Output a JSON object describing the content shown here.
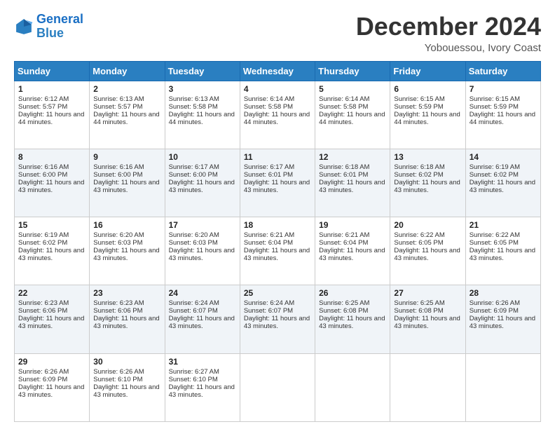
{
  "header": {
    "logo_line1": "General",
    "logo_line2": "Blue",
    "month": "December 2024",
    "location": "Yobouessou, Ivory Coast"
  },
  "weekdays": [
    "Sunday",
    "Monday",
    "Tuesday",
    "Wednesday",
    "Thursday",
    "Friday",
    "Saturday"
  ],
  "weeks": [
    [
      {
        "day": "1",
        "sunrise": "6:12 AM",
        "sunset": "5:57 PM",
        "daylight": "11 hours and 44 minutes."
      },
      {
        "day": "2",
        "sunrise": "6:13 AM",
        "sunset": "5:57 PM",
        "daylight": "11 hours and 44 minutes."
      },
      {
        "day": "3",
        "sunrise": "6:13 AM",
        "sunset": "5:58 PM",
        "daylight": "11 hours and 44 minutes."
      },
      {
        "day": "4",
        "sunrise": "6:14 AM",
        "sunset": "5:58 PM",
        "daylight": "11 hours and 44 minutes."
      },
      {
        "day": "5",
        "sunrise": "6:14 AM",
        "sunset": "5:58 PM",
        "daylight": "11 hours and 44 minutes."
      },
      {
        "day": "6",
        "sunrise": "6:15 AM",
        "sunset": "5:59 PM",
        "daylight": "11 hours and 44 minutes."
      },
      {
        "day": "7",
        "sunrise": "6:15 AM",
        "sunset": "5:59 PM",
        "daylight": "11 hours and 44 minutes."
      }
    ],
    [
      {
        "day": "8",
        "sunrise": "6:16 AM",
        "sunset": "6:00 PM",
        "daylight": "11 hours and 43 minutes."
      },
      {
        "day": "9",
        "sunrise": "6:16 AM",
        "sunset": "6:00 PM",
        "daylight": "11 hours and 43 minutes."
      },
      {
        "day": "10",
        "sunrise": "6:17 AM",
        "sunset": "6:00 PM",
        "daylight": "11 hours and 43 minutes."
      },
      {
        "day": "11",
        "sunrise": "6:17 AM",
        "sunset": "6:01 PM",
        "daylight": "11 hours and 43 minutes."
      },
      {
        "day": "12",
        "sunrise": "6:18 AM",
        "sunset": "6:01 PM",
        "daylight": "11 hours and 43 minutes."
      },
      {
        "day": "13",
        "sunrise": "6:18 AM",
        "sunset": "6:02 PM",
        "daylight": "11 hours and 43 minutes."
      },
      {
        "day": "14",
        "sunrise": "6:19 AM",
        "sunset": "6:02 PM",
        "daylight": "11 hours and 43 minutes."
      }
    ],
    [
      {
        "day": "15",
        "sunrise": "6:19 AM",
        "sunset": "6:02 PM",
        "daylight": "11 hours and 43 minutes."
      },
      {
        "day": "16",
        "sunrise": "6:20 AM",
        "sunset": "6:03 PM",
        "daylight": "11 hours and 43 minutes."
      },
      {
        "day": "17",
        "sunrise": "6:20 AM",
        "sunset": "6:03 PM",
        "daylight": "11 hours and 43 minutes."
      },
      {
        "day": "18",
        "sunrise": "6:21 AM",
        "sunset": "6:04 PM",
        "daylight": "11 hours and 43 minutes."
      },
      {
        "day": "19",
        "sunrise": "6:21 AM",
        "sunset": "6:04 PM",
        "daylight": "11 hours and 43 minutes."
      },
      {
        "day": "20",
        "sunrise": "6:22 AM",
        "sunset": "6:05 PM",
        "daylight": "11 hours and 43 minutes."
      },
      {
        "day": "21",
        "sunrise": "6:22 AM",
        "sunset": "6:05 PM",
        "daylight": "11 hours and 43 minutes."
      }
    ],
    [
      {
        "day": "22",
        "sunrise": "6:23 AM",
        "sunset": "6:06 PM",
        "daylight": "11 hours and 43 minutes."
      },
      {
        "day": "23",
        "sunrise": "6:23 AM",
        "sunset": "6:06 PM",
        "daylight": "11 hours and 43 minutes."
      },
      {
        "day": "24",
        "sunrise": "6:24 AM",
        "sunset": "6:07 PM",
        "daylight": "11 hours and 43 minutes."
      },
      {
        "day": "25",
        "sunrise": "6:24 AM",
        "sunset": "6:07 PM",
        "daylight": "11 hours and 43 minutes."
      },
      {
        "day": "26",
        "sunrise": "6:25 AM",
        "sunset": "6:08 PM",
        "daylight": "11 hours and 43 minutes."
      },
      {
        "day": "27",
        "sunrise": "6:25 AM",
        "sunset": "6:08 PM",
        "daylight": "11 hours and 43 minutes."
      },
      {
        "day": "28",
        "sunrise": "6:26 AM",
        "sunset": "6:09 PM",
        "daylight": "11 hours and 43 minutes."
      }
    ],
    [
      {
        "day": "29",
        "sunrise": "6:26 AM",
        "sunset": "6:09 PM",
        "daylight": "11 hours and 43 minutes."
      },
      {
        "day": "30",
        "sunrise": "6:26 AM",
        "sunset": "6:10 PM",
        "daylight": "11 hours and 43 minutes."
      },
      {
        "day": "31",
        "sunrise": "6:27 AM",
        "sunset": "6:10 PM",
        "daylight": "11 hours and 43 minutes."
      },
      null,
      null,
      null,
      null
    ]
  ]
}
